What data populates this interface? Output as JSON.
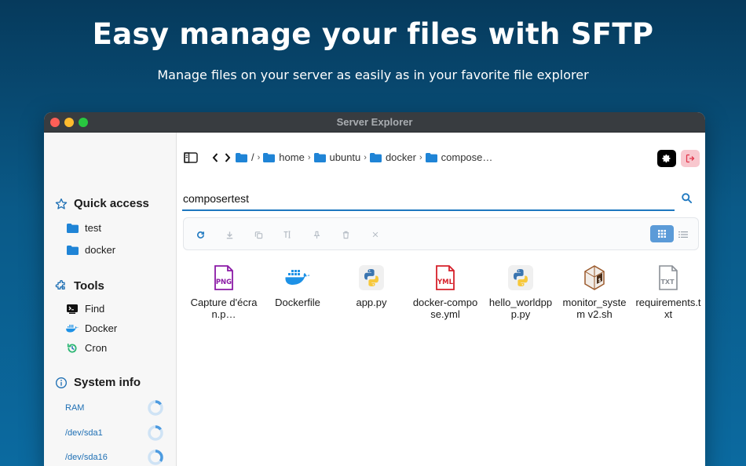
{
  "hero": {
    "title": "Easy manage your files with SFTP",
    "subtitle": "Manage files on your server as easily as in your favorite file explorer"
  },
  "window": {
    "title": "Server Explorer"
  },
  "sidebar": {
    "quick_access": {
      "title": "Quick access",
      "items": [
        {
          "label": "test",
          "icon": "folder-icon"
        },
        {
          "label": "docker",
          "icon": "folder-icon"
        }
      ]
    },
    "tools": {
      "title": "Tools",
      "items": [
        {
          "label": "Find",
          "icon": "terminal-icon"
        },
        {
          "label": "Docker",
          "icon": "docker-icon"
        },
        {
          "label": "Cron",
          "icon": "cron-icon"
        }
      ]
    },
    "system_info": {
      "title": "System info",
      "items": [
        {
          "label": "RAM",
          "usage": 0.15
        },
        {
          "label": "/dev/sda1",
          "usage": 0.15
        },
        {
          "label": "/dev/sda16",
          "usage": 0.35
        }
      ]
    }
  },
  "breadcrumb": {
    "root": "/",
    "items": [
      "home",
      "ubuntu",
      "docker",
      "compose…"
    ]
  },
  "search": {
    "value": "composertest",
    "placeholder": ""
  },
  "colors": {
    "accent": "#1e78c0",
    "folder": "#1f84d6",
    "window_bar": "#383c40"
  },
  "files": [
    {
      "name": "Capture d'écran.p…",
      "icon": "png-file-icon"
    },
    {
      "name": "Dockerfile",
      "icon": "docker-icon"
    },
    {
      "name": "app.py",
      "icon": "python-icon"
    },
    {
      "name": "docker-compose.yml",
      "icon": "yml-file-icon"
    },
    {
      "name": "hello_worldppp.py",
      "icon": "python-icon"
    },
    {
      "name": "monitor_system v2.sh",
      "icon": "shell-script-icon"
    },
    {
      "name": "requirements.txt",
      "icon": "txt-file-icon"
    }
  ]
}
